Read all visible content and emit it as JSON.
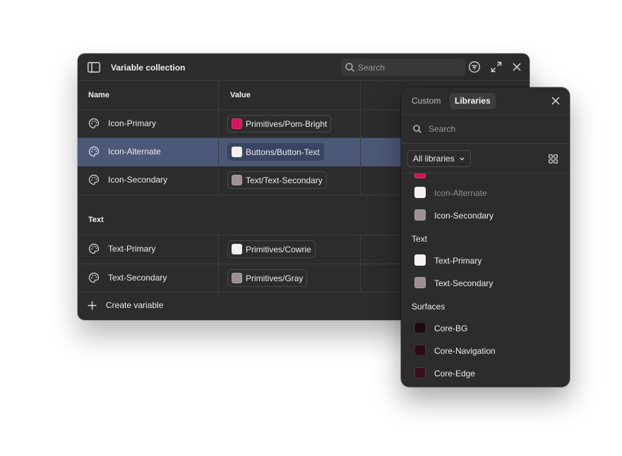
{
  "collection": {
    "title": "Variable collection",
    "search_placeholder": "Search",
    "columns": {
      "name": "Name",
      "value": "Value"
    },
    "rows": [
      {
        "name": "Icon-Primary",
        "value": "Primitives/Pom-Bright",
        "swatch": "#d6145a",
        "selected": false
      },
      {
        "name": "Icon-Alternate",
        "value": "Buttons/Button-Text",
        "swatch": "#f4f1ee",
        "selected": true
      },
      {
        "name": "Icon-Secondary",
        "value": "Text/Text-Secondary",
        "swatch": "#9e8f93",
        "selected": false
      }
    ],
    "group_title": "Text",
    "text_rows": [
      {
        "name": "Text-Primary",
        "value": "Primitives/Cowrie",
        "swatch": "#f4f1ee"
      },
      {
        "name": "Text-Secondary",
        "value": "Primitives/Gray",
        "swatch": "#9e8f93"
      }
    ],
    "create_label": "Create variable"
  },
  "picker": {
    "tabs": {
      "custom": "Custom",
      "libraries": "Libraries"
    },
    "active_tab": "Libraries",
    "search_placeholder": "Search",
    "library_filter": "All libraries",
    "partial_item_swatch": "#d6145a",
    "items_icon": [
      {
        "name": "Icon-Alternate",
        "swatch": "#f4f1ee",
        "dim": true
      },
      {
        "name": "Icon-Secondary",
        "swatch": "#9e8f93",
        "dim": false
      }
    ],
    "section_text": "Text",
    "items_text": [
      {
        "name": "Text-Primary",
        "swatch": "#f4f1ee"
      },
      {
        "name": "Text-Secondary",
        "swatch": "#9e8f93"
      }
    ],
    "section_surfaces": "Surfaces",
    "items_surfaces": [
      {
        "name": "Core-BG",
        "swatch": "#1a0a0f"
      },
      {
        "name": "Core-Navigation",
        "swatch": "#2a0b16"
      },
      {
        "name": "Core-Edge",
        "swatch": "#3a1020"
      }
    ]
  },
  "colors": {
    "panel_bg": "#2c2c2c",
    "selection": "#4c5877",
    "divider": "#3d3d3d"
  }
}
